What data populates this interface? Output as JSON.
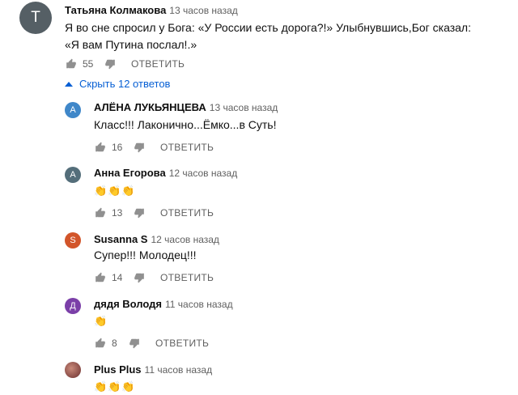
{
  "top_comment": {
    "avatar_letter": "T",
    "avatar_color": "#555f65",
    "author": "Татьяна Колмакова",
    "time": "13 часов назад",
    "text_line1": "Я во сне спросил у Бога: «У России есть дорога?!» Улыбнувшись,Бог сказал:",
    "text_line2": "«Я вам Путина послал!.»",
    "likes": "55",
    "reply_label": "ОТВЕТИТЬ"
  },
  "replies_toggle": {
    "label": "Скрыть 12 ответов",
    "icon": "chevron-up-icon",
    "color": "#065fd4"
  },
  "replies": [
    {
      "avatar_letter": "А",
      "avatar_color": "#3f87c9",
      "author": "АЛЁНА ЛУКЬЯНЦЕВА",
      "time": "13 часов назад",
      "text": "Класс!!! Лаконично...Ёмко...в Суть!",
      "likes": "16",
      "reply_label": "ОТВЕТИТЬ"
    },
    {
      "avatar_letter": "А",
      "avatar_color": "#546e7a",
      "author": "Анна Егорова",
      "time": "12 часов назад",
      "text": "👏👏👏",
      "likes": "13",
      "reply_label": "ОТВЕТИТЬ"
    },
    {
      "avatar_letter": "S",
      "avatar_color": "#d2552a",
      "author": "Susanna S",
      "time": "12 часов назад",
      "text": "Супер!!!  Молодец!!!",
      "likes": "14",
      "reply_label": "ОТВЕТИТЬ"
    },
    {
      "avatar_letter": "Д",
      "avatar_color": "#7b3fa8",
      "author": "дядя Володя",
      "time": "11 часов назад",
      "text": "👏",
      "likes": "8",
      "reply_label": "ОТВЕТИТЬ"
    },
    {
      "avatar_letter": "",
      "avatar_color": "#8a4a4a",
      "author": "Plus Plus",
      "time": "11 часов назад",
      "text": "👏👏👏",
      "likes": "",
      "reply_label": ""
    }
  ]
}
